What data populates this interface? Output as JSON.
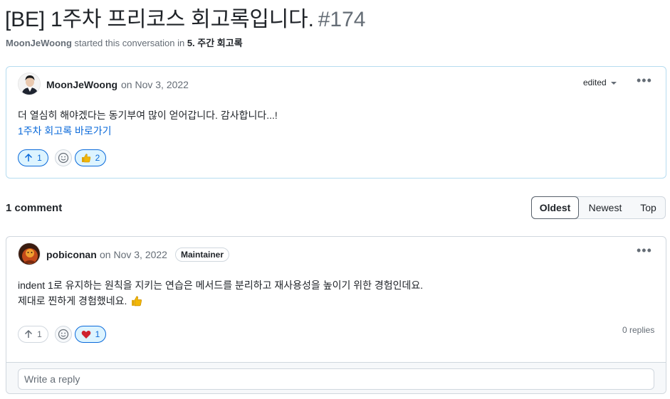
{
  "discussion": {
    "title": "[BE] 1주차 프리코스 회고록입니다.",
    "number": "#174",
    "meta_author": "MoonJeWoong",
    "meta_text": "started this conversation in",
    "category": "5. 주간 회고록"
  },
  "op": {
    "author": "MoonJeWoong",
    "date": "on Nov 3, 2022",
    "edited": "edited",
    "body_line1": "더 열심히 해야겠다는 동기부여 많이 얻어갑니다. 감사합니다...!",
    "link_text": "1주차 회고록 바로가기",
    "upvote_count": "1",
    "thumbs_count": "2"
  },
  "comments_header": {
    "count_label": "1 comment",
    "sort_options": [
      "Oldest",
      "Newest",
      "Top"
    ]
  },
  "comment": {
    "author": "pobiconan",
    "date": "on Nov 3, 2022",
    "badge": "Maintainer",
    "body_line1": "indent 1로 유지하는 원칙을 지키는 연습은 메서드를 분리하고 재사용성을 높이기 위한 경험인데요.",
    "body_line2": "제대로 찐하게 경험했네요.",
    "upvote_count": "1",
    "heart_count": "1",
    "replies": "0 replies",
    "reply_placeholder": "Write a reply"
  },
  "colors": {
    "accent": "#0969da",
    "op_border": "#b6dcf0",
    "reaction_active_bg": "#ddf4ff",
    "heart": "#cf222e",
    "thumbs": "#f2b705"
  }
}
